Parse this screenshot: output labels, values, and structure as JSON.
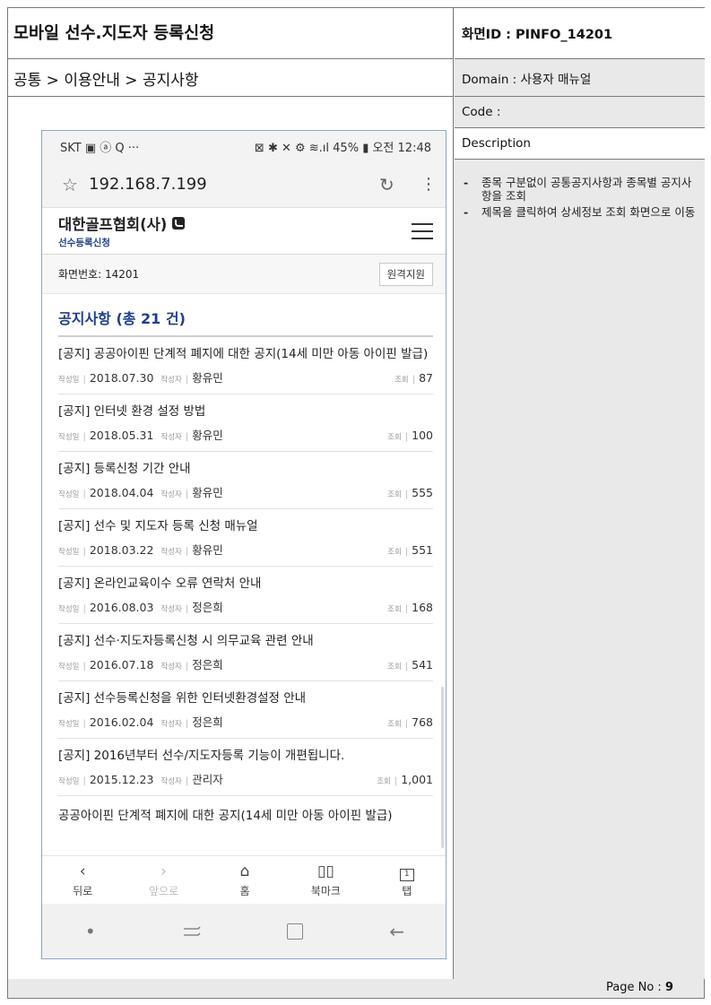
{
  "document": {
    "title": "모바일 선수.지도자 등록신청",
    "breadcrumb": "공통 > 이용안내 > 공지사항",
    "screen_id": "화면ID : PINFO_14201",
    "domain": "Domain : 사용자 매뉴얼",
    "code": "Code :",
    "description_label": "Description",
    "description_items": [
      "종목 구분없이 공통공지사항과 종목별 공지사항을 조회",
      "제목을 클릭하여 상세정보 조회 화면으로 이동"
    ],
    "page_no_label": "Page No :",
    "page_no": "9"
  },
  "phone": {
    "status_left": "SKT ▣ ⓐ Q ···",
    "status_right": "⊠ ✱ ✕ ⚙ ≋.ıl 45% ▮ 오전 12:48",
    "url": "192.168.7.199",
    "site_name": "대한골프협회(사)",
    "site_sub": "선수등록신청",
    "screen_number": "화면번호: 14201",
    "remote_button": "원격지원",
    "list_title": "공지사항 (총 21 건)",
    "meta_labels": {
      "date": "작성일",
      "author": "작성자",
      "views": "조회"
    },
    "notices": [
      {
        "title": "[공지] 공공아이핀 단계적 폐지에 대한 공지(14세 미만 아동 아이핀 발급)",
        "date": "2018.07.30",
        "author": "황유민",
        "views": "87"
      },
      {
        "title": "[공지] 인터넷 환경 설정 방법",
        "date": "2018.05.31",
        "author": "황유민",
        "views": "100"
      },
      {
        "title": "[공지] 등록신청 기간 안내",
        "date": "2018.04.04",
        "author": "황유민",
        "views": "555"
      },
      {
        "title": "[공지] 선수 및 지도자 등록 신청 매뉴얼",
        "date": "2018.03.22",
        "author": "황유민",
        "views": "551"
      },
      {
        "title": "[공지] 온라인교육이수 오류 연락처 안내",
        "date": "2016.08.03",
        "author": "정은희",
        "views": "168"
      },
      {
        "title": "[공지] 선수·지도자등록신청 시 의무교육 관련 안내",
        "date": "2016.07.18",
        "author": "정은희",
        "views": "541"
      },
      {
        "title": "[공지] 선수등록신청을 위한 인터넷환경설정 안내",
        "date": "2016.02.04",
        "author": "정은희",
        "views": "768"
      },
      {
        "title": "[공지] 2016년부터 선수/지도자등록 기능이 개편됩니다.",
        "date": "2015.12.23",
        "author": "관리자",
        "views": "1,001"
      }
    ],
    "truncated_item": "공공아이핀 단계적 폐지에 대한 공지(14세 미만 아동 아이핀 발급)",
    "bottom_nav": [
      {
        "icon": "‹",
        "label": "뒤로",
        "name": "back"
      },
      {
        "icon": "›",
        "label": "앞으로",
        "name": "forward"
      },
      {
        "icon": "⌂",
        "label": "홈",
        "name": "home"
      },
      {
        "icon": "▯▯",
        "label": "북마크",
        "name": "bookmark"
      },
      {
        "icon": "1",
        "label": "탭",
        "name": "tabs"
      }
    ],
    "system_nav": {
      "dot": "•",
      "back_arrow": "←"
    }
  }
}
